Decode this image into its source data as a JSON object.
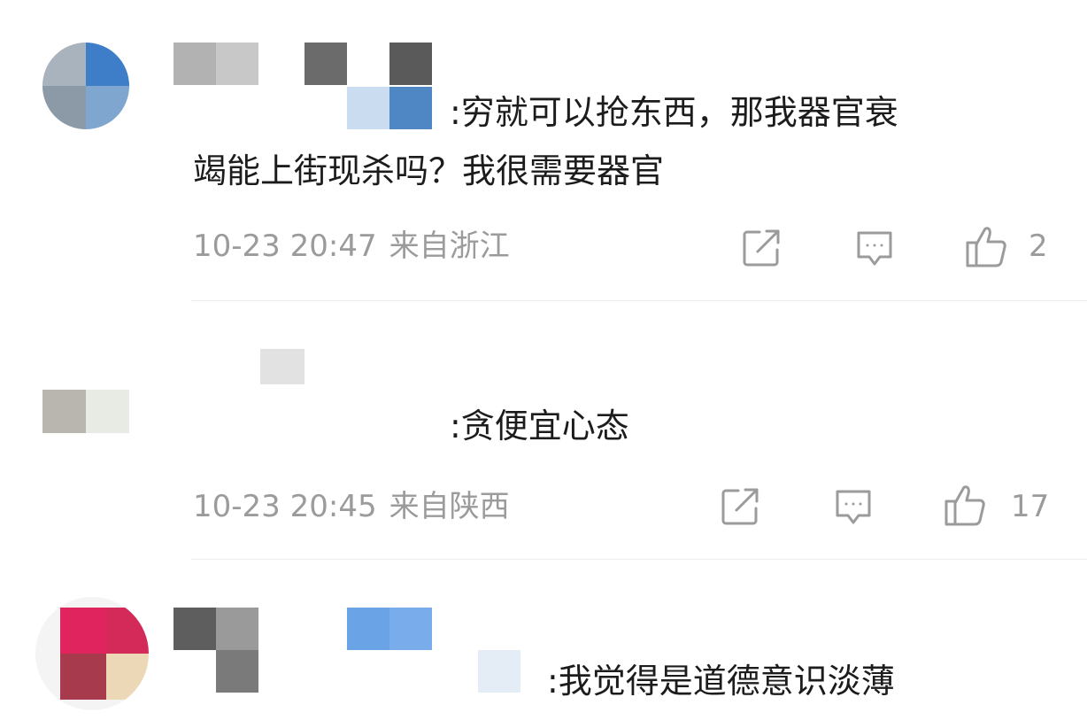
{
  "comments": [
    {
      "text_line1": ":穷就可以抢东西，那我器官衰",
      "text_line2": "竭能上街现杀吗？我很需要器官",
      "time": "10-23 20:47",
      "location": "来自浙江",
      "likes": "2"
    },
    {
      "text_line1": ":贪便宜心态",
      "time": "10-23 20:45",
      "location": "来自陕西",
      "likes": "17"
    },
    {
      "text_line1": ":我觉得是道德意识淡薄"
    }
  ],
  "icons": {
    "share": "share-icon",
    "reply": "reply-icon",
    "like": "thumbs-up-icon"
  },
  "colors": {
    "text": "#1c1c1c",
    "meta": "#9b9b9b",
    "divider": "#ececec"
  }
}
